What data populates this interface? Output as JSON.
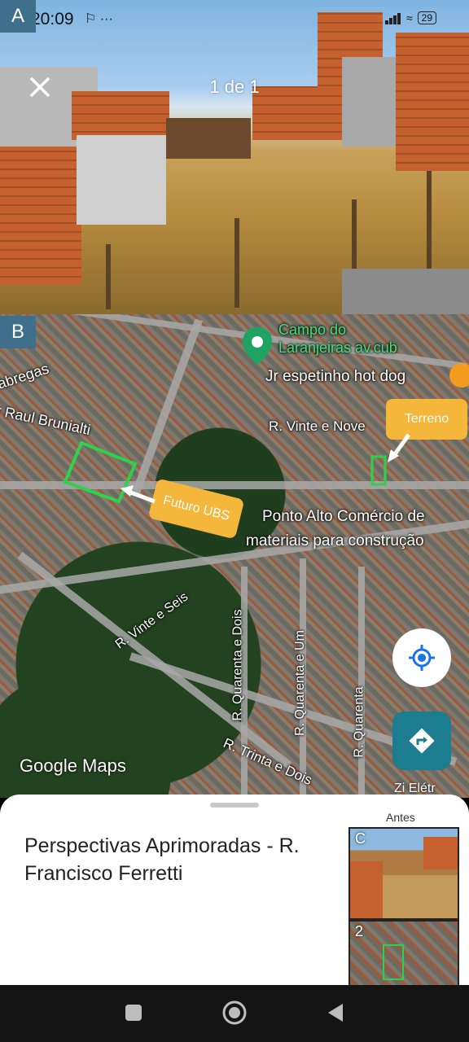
{
  "status_bar": {
    "time": "20:09",
    "system_icons": "⚐ ···",
    "battery": "29"
  },
  "labels": {
    "a": "A",
    "b": "B",
    "c": "C",
    "thumb_2": "2"
  },
  "photo_viewer": {
    "counter": "1 de 1",
    "close_icon": "close-icon"
  },
  "map": {
    "place_campo": "Campo do Laranjeiras av.cub",
    "place_jr": "Jr espetinho hot dog",
    "street_vinte_nove": "R. Vinte e Nove",
    "street_raul": "r Raul Brunialti",
    "street_fabregas": "abregas",
    "store_ponto_alto_line1": "Ponto Alto Comércio de",
    "store_ponto_alto_line2": "materiais para construção",
    "street_vinte_seis": "R. Vinte e Seis",
    "street_quarenta_dois": "R. Quarenta e Dois",
    "street_quarenta_um": "R. Quarenta e Um",
    "street_quarenta": "R. Quarenta",
    "street_trinta_dois": "R. Trinta e Dois",
    "callout_terreno": "Terreno",
    "callout_ubs": "Futuro UBS",
    "logo": "Google Maps",
    "edge_text": "Zi Elétr"
  },
  "sheet": {
    "title": "Perspectivas Aprimoradas - R. Francisco Ferretti",
    "before_label": "Antes"
  },
  "colors": {
    "badge": "#3f6f8a",
    "callout": "#f4b63b",
    "outline": "#2fd14a",
    "directions": "#1c7d90"
  }
}
